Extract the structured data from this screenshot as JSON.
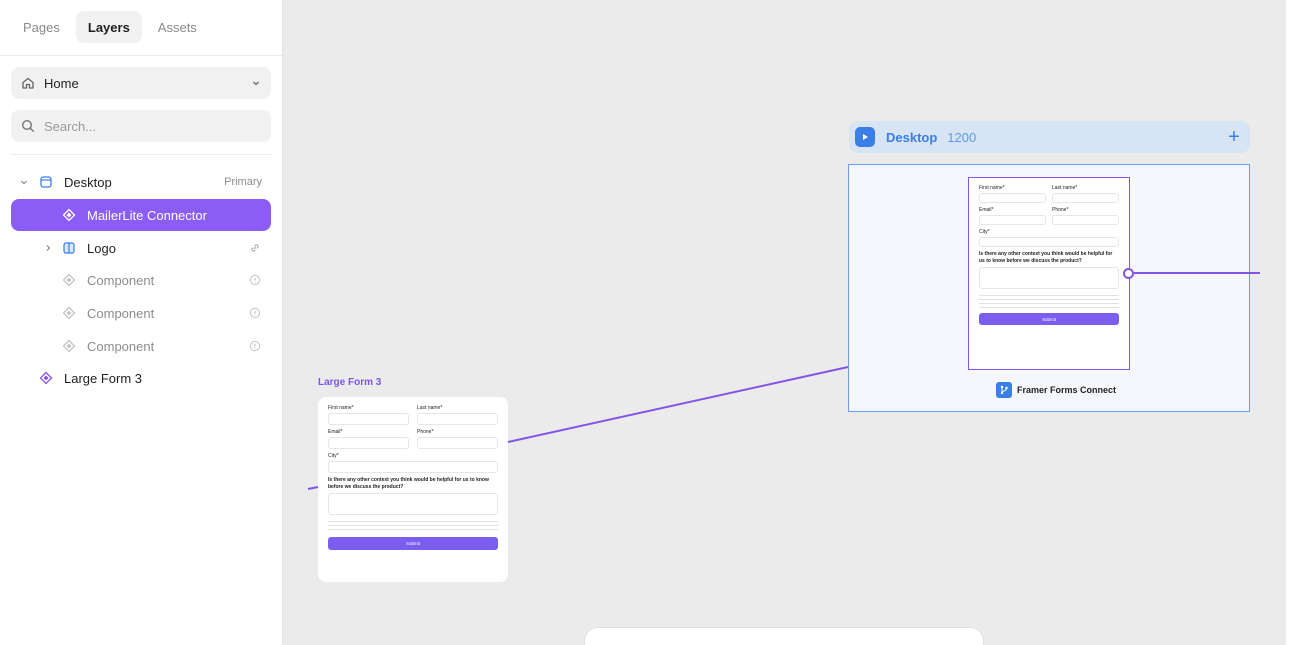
{
  "sidebar": {
    "tabs": [
      {
        "label": "Pages",
        "active": false
      },
      {
        "label": "Layers",
        "active": true
      },
      {
        "label": "Assets",
        "active": false
      }
    ],
    "page_selector": {
      "label": "Home"
    },
    "search": {
      "placeholder": "Search..."
    },
    "layers": [
      {
        "name": "Desktop",
        "meta": "Primary"
      },
      {
        "name": "MailerLite Connector",
        "selected": true
      },
      {
        "name": "Logo"
      },
      {
        "name": "Component"
      },
      {
        "name": "Component"
      },
      {
        "name": "Component"
      },
      {
        "name": "Large Form 3"
      }
    ]
  },
  "canvas": {
    "breakpoint": {
      "title": "Desktop",
      "width": "1200"
    },
    "brand": "Framer Forms Connect",
    "large_form_title": "Large Form 3",
    "accent_color": "#8454e8",
    "breakpoint_color": "#3a7ee6"
  },
  "form": {
    "first_name": "First name*",
    "last_name": "Last name*",
    "email": "Email*",
    "phone": "Phone*",
    "city": "City*",
    "question": "Is there any other context you think would be helpful for us to know before we discuss the product?",
    "submit": "Submit"
  }
}
